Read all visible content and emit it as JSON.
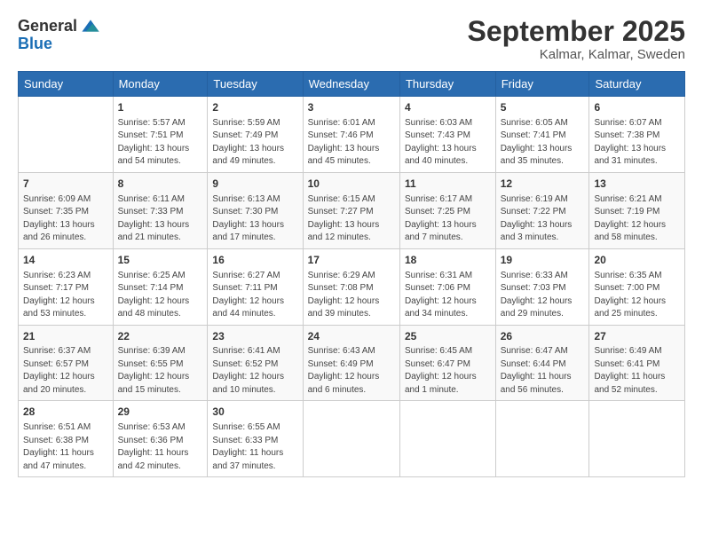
{
  "logo": {
    "general": "General",
    "blue": "Blue"
  },
  "header": {
    "month": "September 2025",
    "location": "Kalmar, Kalmar, Sweden"
  },
  "weekdays": [
    "Sunday",
    "Monday",
    "Tuesday",
    "Wednesday",
    "Thursday",
    "Friday",
    "Saturday"
  ],
  "weeks": [
    [
      {
        "day": "",
        "info": ""
      },
      {
        "day": "1",
        "info": "Sunrise: 5:57 AM\nSunset: 7:51 PM\nDaylight: 13 hours\nand 54 minutes."
      },
      {
        "day": "2",
        "info": "Sunrise: 5:59 AM\nSunset: 7:49 PM\nDaylight: 13 hours\nand 49 minutes."
      },
      {
        "day": "3",
        "info": "Sunrise: 6:01 AM\nSunset: 7:46 PM\nDaylight: 13 hours\nand 45 minutes."
      },
      {
        "day": "4",
        "info": "Sunrise: 6:03 AM\nSunset: 7:43 PM\nDaylight: 13 hours\nand 40 minutes."
      },
      {
        "day": "5",
        "info": "Sunrise: 6:05 AM\nSunset: 7:41 PM\nDaylight: 13 hours\nand 35 minutes."
      },
      {
        "day": "6",
        "info": "Sunrise: 6:07 AM\nSunset: 7:38 PM\nDaylight: 13 hours\nand 31 minutes."
      }
    ],
    [
      {
        "day": "7",
        "info": "Sunrise: 6:09 AM\nSunset: 7:35 PM\nDaylight: 13 hours\nand 26 minutes."
      },
      {
        "day": "8",
        "info": "Sunrise: 6:11 AM\nSunset: 7:33 PM\nDaylight: 13 hours\nand 21 minutes."
      },
      {
        "day": "9",
        "info": "Sunrise: 6:13 AM\nSunset: 7:30 PM\nDaylight: 13 hours\nand 17 minutes."
      },
      {
        "day": "10",
        "info": "Sunrise: 6:15 AM\nSunset: 7:27 PM\nDaylight: 13 hours\nand 12 minutes."
      },
      {
        "day": "11",
        "info": "Sunrise: 6:17 AM\nSunset: 7:25 PM\nDaylight: 13 hours\nand 7 minutes."
      },
      {
        "day": "12",
        "info": "Sunrise: 6:19 AM\nSunset: 7:22 PM\nDaylight: 13 hours\nand 3 minutes."
      },
      {
        "day": "13",
        "info": "Sunrise: 6:21 AM\nSunset: 7:19 PM\nDaylight: 12 hours\nand 58 minutes."
      }
    ],
    [
      {
        "day": "14",
        "info": "Sunrise: 6:23 AM\nSunset: 7:17 PM\nDaylight: 12 hours\nand 53 minutes."
      },
      {
        "day": "15",
        "info": "Sunrise: 6:25 AM\nSunset: 7:14 PM\nDaylight: 12 hours\nand 48 minutes."
      },
      {
        "day": "16",
        "info": "Sunrise: 6:27 AM\nSunset: 7:11 PM\nDaylight: 12 hours\nand 44 minutes."
      },
      {
        "day": "17",
        "info": "Sunrise: 6:29 AM\nSunset: 7:08 PM\nDaylight: 12 hours\nand 39 minutes."
      },
      {
        "day": "18",
        "info": "Sunrise: 6:31 AM\nSunset: 7:06 PM\nDaylight: 12 hours\nand 34 minutes."
      },
      {
        "day": "19",
        "info": "Sunrise: 6:33 AM\nSunset: 7:03 PM\nDaylight: 12 hours\nand 29 minutes."
      },
      {
        "day": "20",
        "info": "Sunrise: 6:35 AM\nSunset: 7:00 PM\nDaylight: 12 hours\nand 25 minutes."
      }
    ],
    [
      {
        "day": "21",
        "info": "Sunrise: 6:37 AM\nSunset: 6:57 PM\nDaylight: 12 hours\nand 20 minutes."
      },
      {
        "day": "22",
        "info": "Sunrise: 6:39 AM\nSunset: 6:55 PM\nDaylight: 12 hours\nand 15 minutes."
      },
      {
        "day": "23",
        "info": "Sunrise: 6:41 AM\nSunset: 6:52 PM\nDaylight: 12 hours\nand 10 minutes."
      },
      {
        "day": "24",
        "info": "Sunrise: 6:43 AM\nSunset: 6:49 PM\nDaylight: 12 hours\nand 6 minutes."
      },
      {
        "day": "25",
        "info": "Sunrise: 6:45 AM\nSunset: 6:47 PM\nDaylight: 12 hours\nand 1 minute."
      },
      {
        "day": "26",
        "info": "Sunrise: 6:47 AM\nSunset: 6:44 PM\nDaylight: 11 hours\nand 56 minutes."
      },
      {
        "day": "27",
        "info": "Sunrise: 6:49 AM\nSunset: 6:41 PM\nDaylight: 11 hours\nand 52 minutes."
      }
    ],
    [
      {
        "day": "28",
        "info": "Sunrise: 6:51 AM\nSunset: 6:38 PM\nDaylight: 11 hours\nand 47 minutes."
      },
      {
        "day": "29",
        "info": "Sunrise: 6:53 AM\nSunset: 6:36 PM\nDaylight: 11 hours\nand 42 minutes."
      },
      {
        "day": "30",
        "info": "Sunrise: 6:55 AM\nSunset: 6:33 PM\nDaylight: 11 hours\nand 37 minutes."
      },
      {
        "day": "",
        "info": ""
      },
      {
        "day": "",
        "info": ""
      },
      {
        "day": "",
        "info": ""
      },
      {
        "day": "",
        "info": ""
      }
    ]
  ]
}
